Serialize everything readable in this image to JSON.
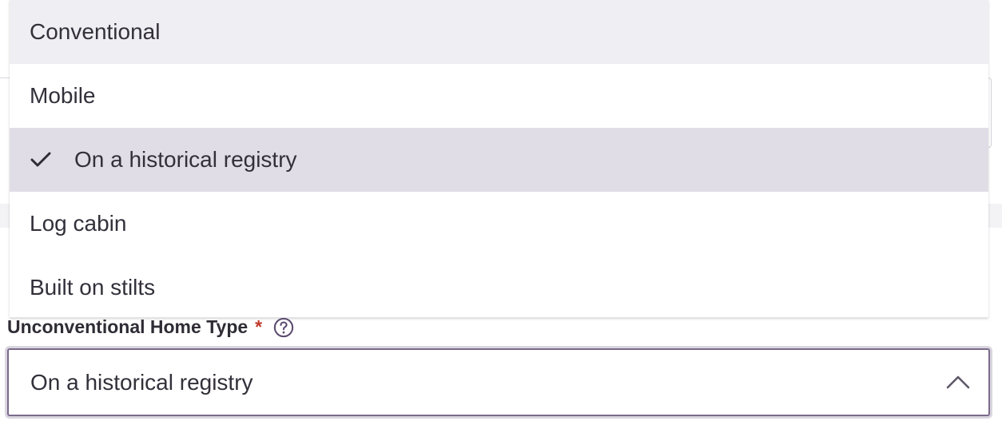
{
  "dropdown": {
    "options": [
      {
        "label": "Conventional",
        "state": "hover"
      },
      {
        "label": "Mobile",
        "state": "normal"
      },
      {
        "label": "On a historical registry",
        "state": "selected"
      },
      {
        "label": "Log cabin",
        "state": "normal"
      },
      {
        "label": "Built on stilts",
        "state": "normal"
      }
    ]
  },
  "field": {
    "label": "Unconventional Home Type",
    "required_mark": "*",
    "help_icon": "question-circle-icon",
    "selected_value": "On a historical registry",
    "toggle_icon": "chevron-up-icon"
  },
  "colors": {
    "accent": "#7a6a8c",
    "required": "#c0392b",
    "selected_bg": "#e0dde6",
    "hover_bg": "#efeef2"
  }
}
